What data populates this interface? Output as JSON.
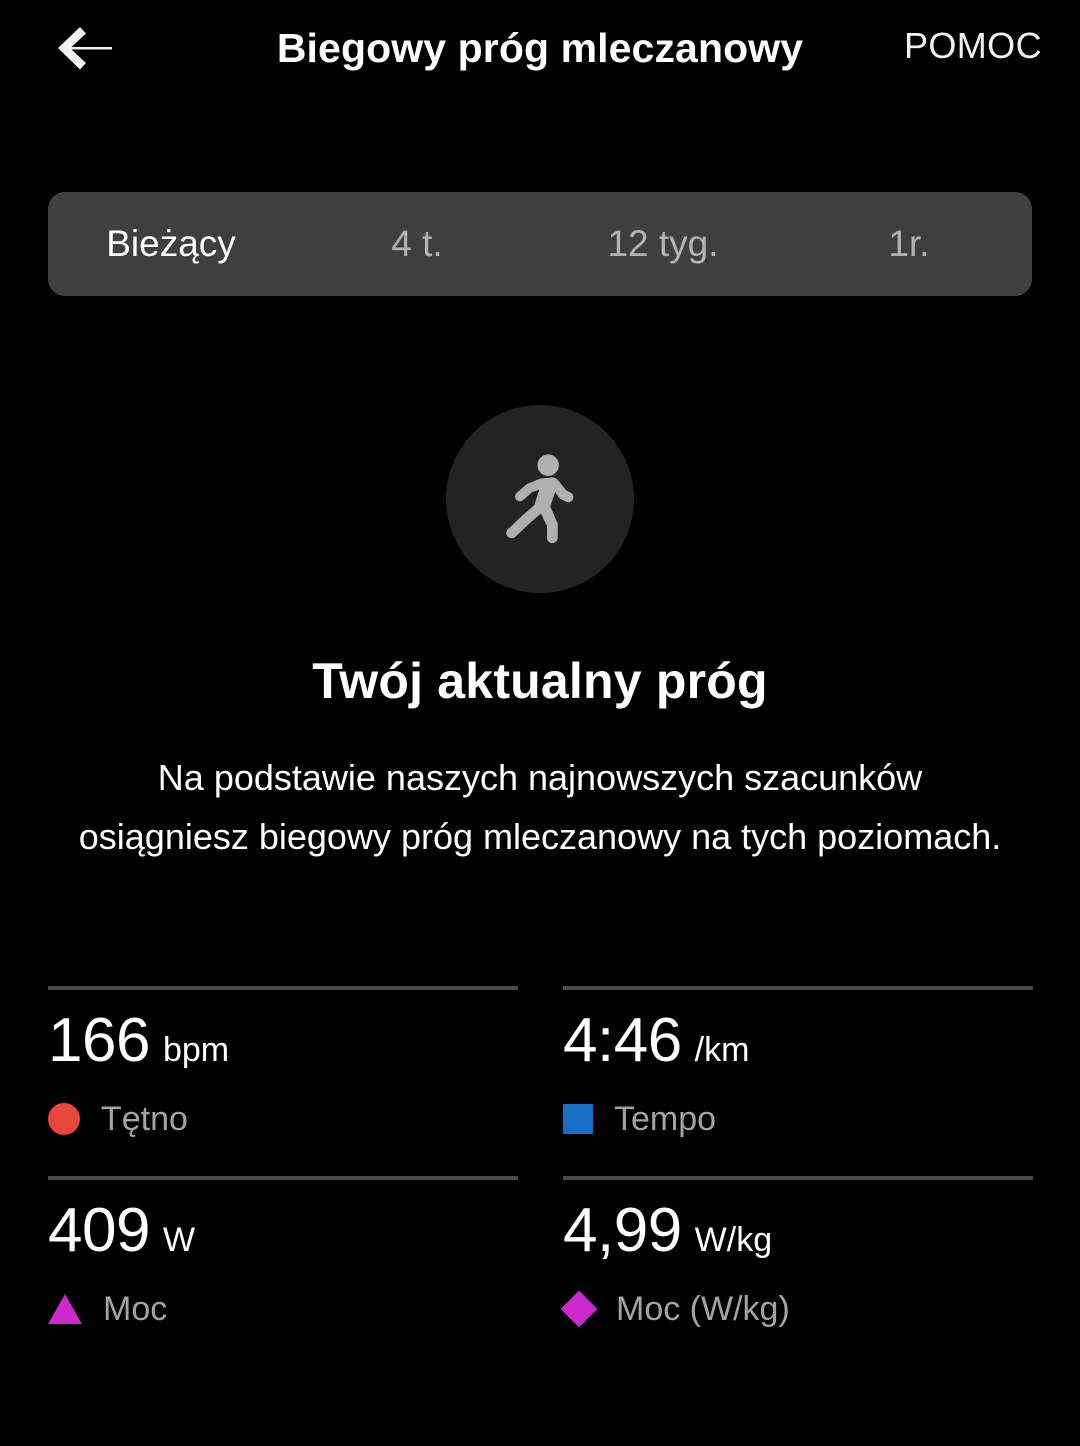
{
  "header": {
    "back_icon": "back-arrow-icon",
    "title": "Biegowy próg mleczanowy",
    "help_label": "POMOC"
  },
  "tabs": [
    {
      "label": "Bieżący",
      "active": true
    },
    {
      "label": "4 t.",
      "active": false
    },
    {
      "label": "12 tyg.",
      "active": false
    },
    {
      "label": "1r.",
      "active": false
    }
  ],
  "hero": {
    "icon": "running-person-icon",
    "circle_color": "#232323",
    "icon_color": "#b0b0b0"
  },
  "content": {
    "headline": "Twój aktualny próg",
    "description": "Na podstawie naszych najnowszych szacunków osiągniesz biegowy próg mleczanowy na tych poziomach."
  },
  "metrics": [
    {
      "value": "166",
      "unit": "bpm",
      "label": "Tętno",
      "marker_shape": "circle",
      "marker_color": "#e8453c"
    },
    {
      "value": "4:46",
      "unit": "/km",
      "label": "Tempo",
      "marker_shape": "square",
      "marker_color": "#1a6fc4"
    },
    {
      "value": "409",
      "unit": "W",
      "label": "Moc",
      "marker_shape": "triangle",
      "marker_color": "#cc28cc"
    },
    {
      "value": "4,99",
      "unit": "W/kg",
      "label": "Moc (W/kg)",
      "marker_shape": "diamond",
      "marker_color": "#cc28cc"
    }
  ]
}
